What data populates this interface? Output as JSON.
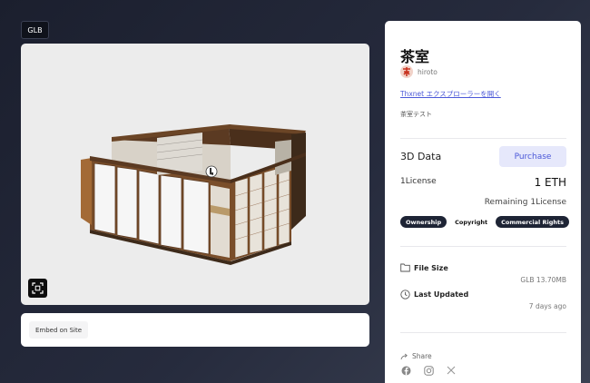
{
  "viewer": {
    "format_badge": "GLB",
    "embed_label": "Embed on Site"
  },
  "item": {
    "title": "茶室",
    "author": "hiroto",
    "explorer_link": "Thxnet エクスプローラーを開く",
    "description": "茶室テスト"
  },
  "data_section": {
    "label": "3D Data",
    "purchase_label": "Purchase",
    "license_label": "1License",
    "price": "1 ETH",
    "remaining": "Remaining 1License",
    "tags": [
      "Ownership",
      "Copyright",
      "Commercial Rights"
    ]
  },
  "file_info": {
    "file_size_label": "File Size",
    "file_size_value": "GLB 13.70MB",
    "updated_label": "Last Updated",
    "updated_value": "7 days ago"
  },
  "share": {
    "label": "Share",
    "icons": [
      "facebook-icon",
      "instagram-icon",
      "x-icon"
    ]
  },
  "colors": {
    "accent": "#4b58d8",
    "purchase_bg": "#e6e8fb",
    "tag_dark": "#1e2435",
    "page_bg": "#1b1f2e"
  }
}
